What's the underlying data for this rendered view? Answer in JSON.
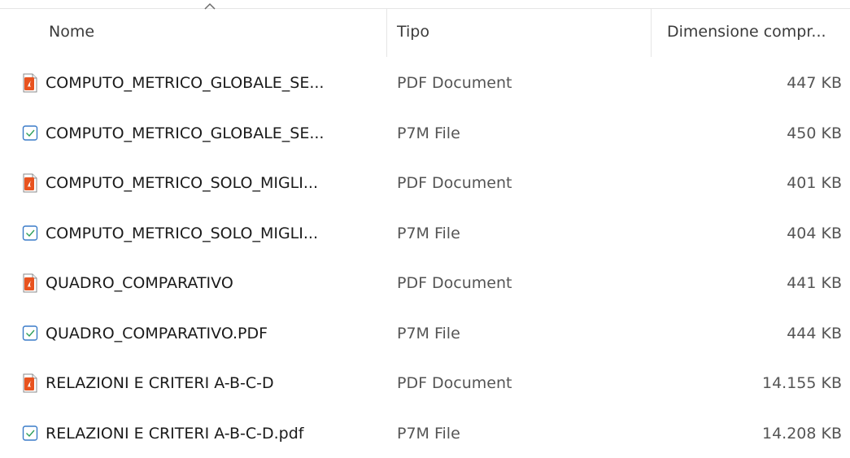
{
  "columns": {
    "name": "Nome",
    "type": "Tipo",
    "size": "Dimensione compr..."
  },
  "sort": {
    "column": "Nome",
    "direction": "ascending",
    "icon": "sort-up-chevron-icon"
  },
  "colors": {
    "pdf_icon": "#e8531f",
    "p7m_icon": "#3a7bc8",
    "p7m_check": "#2e9e5b"
  },
  "files": [
    {
      "name": "COMPUTO_METRICO_GLOBALE_SE...",
      "type": "PDF Document",
      "size": "447 KB",
      "icon": "pdf-file-icon"
    },
    {
      "name": "COMPUTO_METRICO_GLOBALE_SE...",
      "type": "P7M File",
      "size": "450 KB",
      "icon": "p7m-file-icon"
    },
    {
      "name": "COMPUTO_METRICO_SOLO_MIGLI...",
      "type": "PDF Document",
      "size": "401 KB",
      "icon": "pdf-file-icon"
    },
    {
      "name": "COMPUTO_METRICO_SOLO_MIGLI...",
      "type": "P7M File",
      "size": "404 KB",
      "icon": "p7m-file-icon"
    },
    {
      "name": "QUADRO_COMPARATIVO",
      "type": "PDF Document",
      "size": "441 KB",
      "icon": "pdf-file-icon"
    },
    {
      "name": "QUADRO_COMPARATIVO.PDF",
      "type": "P7M File",
      "size": "444 KB",
      "icon": "p7m-file-icon"
    },
    {
      "name": "RELAZIONI E CRITERI A-B-C-D",
      "type": "PDF Document",
      "size": "14.155 KB",
      "icon": "pdf-file-icon"
    },
    {
      "name": "RELAZIONI E CRITERI A-B-C-D.pdf",
      "type": "P7M File",
      "size": "14.208 KB",
      "icon": "p7m-file-icon"
    }
  ]
}
